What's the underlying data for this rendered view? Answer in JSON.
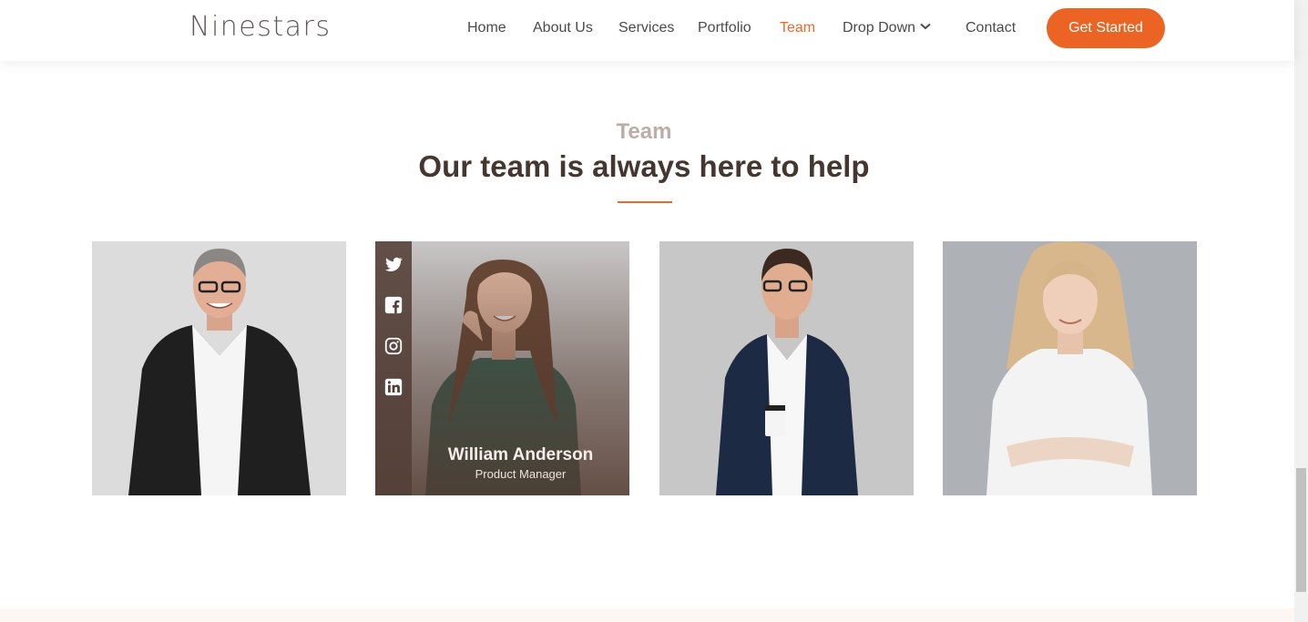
{
  "brand": {
    "logo": "Ninestars",
    "accent": "#ec6424"
  },
  "nav": {
    "items": [
      {
        "label": "Home"
      },
      {
        "label": "About Us"
      },
      {
        "label": "Services"
      },
      {
        "label": "Portfolio"
      },
      {
        "label": "Team",
        "active": true
      },
      {
        "label": "Drop Down",
        "icon": "chevron-down-icon"
      },
      {
        "label": "Contact"
      }
    ],
    "cta": "Get Started"
  },
  "section": {
    "label": "Team",
    "title": "Our team is always here to help"
  },
  "team": {
    "members": [
      {
        "photo": "man-in-black-blazer-with-glasses"
      },
      {
        "photo": "woman-with-long-hair-green-top",
        "name": "William Anderson",
        "role": "Product Manager",
        "social": [
          "twitter-icon",
          "facebook-icon",
          "instagram-icon",
          "linkedin-icon"
        ]
      },
      {
        "photo": "man-in-navy-blazer-holding-coffee"
      },
      {
        "photo": "woman-in-white-blouse-arms-crossed"
      }
    ]
  }
}
